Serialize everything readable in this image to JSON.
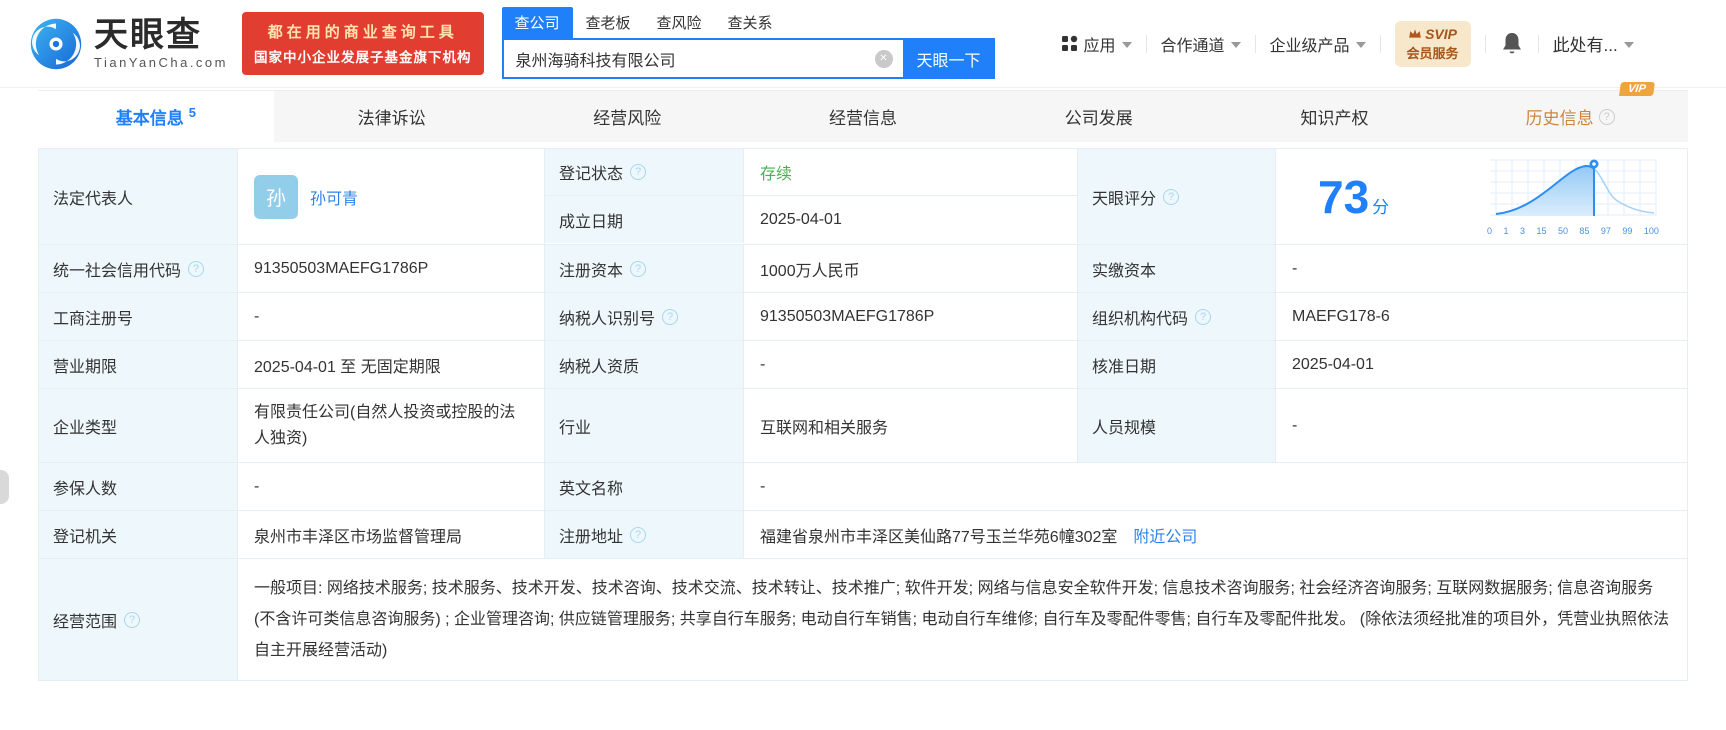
{
  "brand": {
    "name": "天眼查",
    "domain": "TianYanCha.com"
  },
  "promo": {
    "line1": "都在用的商业查询工具",
    "line2": "国家中小企业发展子基金旗下机构"
  },
  "search": {
    "tab_company": "查公司",
    "tab_boss": "查老板",
    "tab_risk": "查风险",
    "tab_relation": "查关系",
    "query": "泉州海骑科技有限公司",
    "button": "天眼一下"
  },
  "nav": {
    "apps": "应用",
    "channel": "合作通道",
    "enterprise": "企业级产品",
    "svip_top": "SVIP",
    "svip_bottom": "会员服务",
    "more": "此处有..."
  },
  "tabs": {
    "basic": "基本信息",
    "basic_count": "5",
    "legal": "法律诉讼",
    "risk": "经营风险",
    "operation": "经营信息",
    "development": "公司发展",
    "ip": "知识产权",
    "history": "历史信息",
    "history_vip": "VIP"
  },
  "fields": {
    "legal_rep_label": "法定代表人",
    "legal_rep_avatar": "孙",
    "legal_rep_name": "孙可青",
    "reg_status_label": "登记状态",
    "reg_status_value": "存续",
    "est_date_label": "成立日期",
    "est_date_value": "2025-04-01",
    "score_label": "天眼评分",
    "score_value": "73",
    "score_unit": "分",
    "credit_code_label": "统一社会信用代码",
    "credit_code_value": "91350503MAEFG1786P",
    "reg_capital_label": "注册资本",
    "reg_capital_value": "1000万人民币",
    "paid_capital_label": "实缴资本",
    "paid_capital_value": "-",
    "reg_no_label": "工商注册号",
    "reg_no_value": "-",
    "taxpayer_id_label": "纳税人识别号",
    "taxpayer_id_value": "91350503MAEFG1786P",
    "org_code_label": "组织机构代码",
    "org_code_value": "MAEFG178-6",
    "term_label": "营业期限",
    "term_value": "2025-04-01 至 无固定期限",
    "taxpayer_quality_label": "纳税人资质",
    "taxpayer_quality_value": "-",
    "approval_date_label": "核准日期",
    "approval_date_value": "2025-04-01",
    "company_type_label": "企业类型",
    "company_type_value": "有限责任公司(自然人投资或控股的法人独资)",
    "industry_label": "行业",
    "industry_value": "互联网和相关服务",
    "staff_label": "人员规模",
    "staff_value": "-",
    "insured_label": "参保人数",
    "insured_value": "-",
    "en_name_label": "英文名称",
    "en_name_value": "-",
    "authority_label": "登记机关",
    "authority_value": "泉州市丰泽区市场监督管理局",
    "address_label": "注册地址",
    "address_value": "福建省泉州市丰泽区美仙路77号玉兰华苑6幢302室",
    "address_link": "附近公司",
    "scope_label": "经营范围",
    "scope_value": "一般项目: 网络技术服务; 技术服务、技术开发、技术咨询、技术交流、技术转让、技术推广; 软件开发; 网络与信息安全软件开发; 信息技术咨询服务; 社会经济咨询服务; 互联网数据服务; 信息咨询服务 (不含许可类信息咨询服务) ; 企业管理咨询; 供应链管理服务; 共享自行车服务; 电动自行车销售; 电动自行车维修; 自行车及零配件零售; 自行车及零配件批发。 (除依法须经批准的项目外，凭营业执照依法自主开展经营活动)"
  },
  "score_chart": {
    "type": "area",
    "score": 73,
    "ticks": [
      "0",
      "1",
      "3",
      "15",
      "50",
      "85",
      "97",
      "99",
      "100"
    ],
    "accent": "#2f8df2"
  },
  "colors": {
    "accent": "#1f80f9",
    "green": "#4caf50",
    "orange": "#c9873f",
    "red": "#e23d31"
  }
}
